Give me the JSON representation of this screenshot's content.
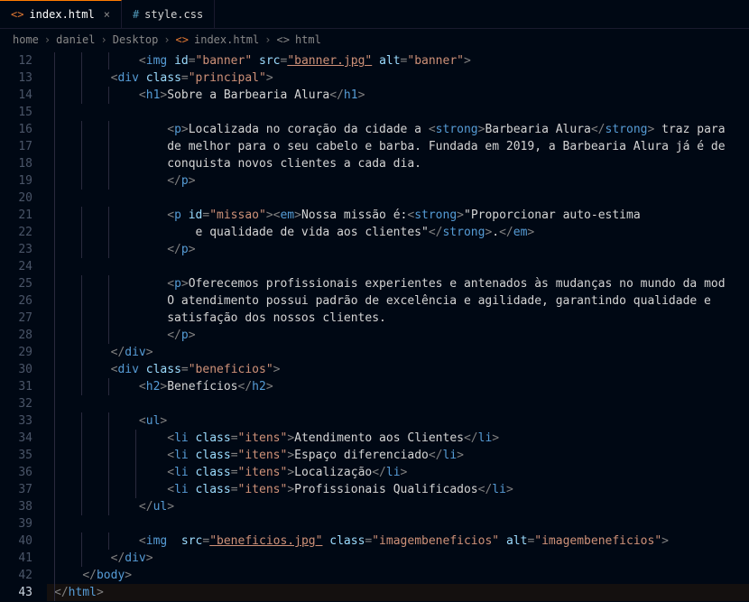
{
  "tabs": [
    {
      "icon": "<>",
      "label": "index.html",
      "active": true
    },
    {
      "icon": "#",
      "label": "style.css",
      "active": false
    }
  ],
  "breadcrumb": {
    "parts": [
      "home",
      "daniel",
      "Desktop"
    ],
    "file": "index.html",
    "symbol": "html"
  },
  "gutter_start": 12,
  "gutter_end": 43,
  "active_line": 43,
  "code_lines": [
    {
      "indent": 3,
      "tokens": [
        [
          "punct",
          "<"
        ],
        [
          "tag",
          "img"
        ],
        [
          "txt",
          " "
        ],
        [
          "attr",
          "id"
        ],
        [
          "punct",
          "="
        ],
        [
          "str",
          "\"banner\""
        ],
        [
          "txt",
          " "
        ],
        [
          "attr",
          "src"
        ],
        [
          "punct",
          "="
        ],
        [
          "str underline",
          "\"banner.jpg\""
        ],
        [
          "txt",
          " "
        ],
        [
          "attr",
          "alt"
        ],
        [
          "punct",
          "="
        ],
        [
          "str",
          "\"banner\""
        ],
        [
          "punct",
          ">"
        ]
      ]
    },
    {
      "indent": 2,
      "tokens": [
        [
          "punct",
          "<"
        ],
        [
          "tag",
          "div"
        ],
        [
          "txt",
          " "
        ],
        [
          "attr",
          "class"
        ],
        [
          "punct",
          "="
        ],
        [
          "str",
          "\"principal\""
        ],
        [
          "punct",
          ">"
        ]
      ]
    },
    {
      "indent": 3,
      "tokens": [
        [
          "punct",
          "<"
        ],
        [
          "tag",
          "h1"
        ],
        [
          "punct",
          ">"
        ],
        [
          "txt",
          "Sobre a Barbearia Alura"
        ],
        [
          "punct",
          "</"
        ],
        [
          "tag",
          "h1"
        ],
        [
          "punct",
          ">"
        ]
      ]
    },
    {
      "indent": 0,
      "tokens": []
    },
    {
      "indent": 3,
      "tokens": [
        [
          "punct",
          "    <"
        ],
        [
          "tag",
          "p"
        ],
        [
          "punct",
          ">"
        ],
        [
          "txt",
          "Localizada no coração da cidade a "
        ],
        [
          "punct",
          "<"
        ],
        [
          "tag",
          "strong"
        ],
        [
          "punct",
          ">"
        ],
        [
          "txt",
          "Barbearia Alura"
        ],
        [
          "punct",
          "</"
        ],
        [
          "tag",
          "strong"
        ],
        [
          "punct",
          ">"
        ],
        [
          "txt",
          " traz para"
        ]
      ]
    },
    {
      "indent": 3,
      "tokens": [
        [
          "txt",
          "    de melhor para o seu cabelo e barba. Fundada em 2019, a Barbearia Alura já é de"
        ]
      ]
    },
    {
      "indent": 3,
      "tokens": [
        [
          "txt",
          "    conquista novos clientes a cada dia."
        ]
      ]
    },
    {
      "indent": 3,
      "tokens": [
        [
          "punct",
          "    </"
        ],
        [
          "tag",
          "p"
        ],
        [
          "punct",
          ">"
        ]
      ]
    },
    {
      "indent": 0,
      "tokens": []
    },
    {
      "indent": 3,
      "tokens": [
        [
          "punct",
          "    <"
        ],
        [
          "tag",
          "p"
        ],
        [
          "txt",
          " "
        ],
        [
          "attr",
          "id"
        ],
        [
          "punct",
          "="
        ],
        [
          "str",
          "\"missao\""
        ],
        [
          "punct",
          "><"
        ],
        [
          "tag",
          "em"
        ],
        [
          "punct",
          ">"
        ],
        [
          "txt",
          "Nossa missão é:"
        ],
        [
          "punct",
          "<"
        ],
        [
          "tag",
          "strong"
        ],
        [
          "punct",
          ">"
        ],
        [
          "txt",
          "\"Proporcionar auto-estima"
        ]
      ]
    },
    {
      "indent": 3,
      "tokens": [
        [
          "txt",
          "        e qualidade de vida aos clientes\""
        ],
        [
          "punct",
          "</"
        ],
        [
          "tag",
          "strong"
        ],
        [
          "punct",
          ">"
        ],
        [
          "txt",
          "."
        ],
        [
          "punct",
          "</"
        ],
        [
          "tag",
          "em"
        ],
        [
          "punct",
          ">"
        ]
      ]
    },
    {
      "indent": 3,
      "tokens": [
        [
          "punct",
          "    </"
        ],
        [
          "tag",
          "p"
        ],
        [
          "punct",
          ">"
        ]
      ]
    },
    {
      "indent": 0,
      "tokens": []
    },
    {
      "indent": 3,
      "tokens": [
        [
          "punct",
          "    <"
        ],
        [
          "tag",
          "p"
        ],
        [
          "punct",
          ">"
        ],
        [
          "txt",
          "Oferecemos profissionais experientes e antenados às mudanças no mundo da mod"
        ]
      ]
    },
    {
      "indent": 3,
      "tokens": [
        [
          "txt",
          "    O atendimento possui padrão de excelência e agilidade, garantindo qualidade e"
        ]
      ]
    },
    {
      "indent": 3,
      "tokens": [
        [
          "txt",
          "    satisfação dos nossos clientes."
        ]
      ]
    },
    {
      "indent": 3,
      "tokens": [
        [
          "punct",
          "    </"
        ],
        [
          "tag",
          "p"
        ],
        [
          "punct",
          ">"
        ]
      ]
    },
    {
      "indent": 2,
      "tokens": [
        [
          "punct",
          "</"
        ],
        [
          "tag",
          "div"
        ],
        [
          "punct",
          ">"
        ]
      ]
    },
    {
      "indent": 2,
      "tokens": [
        [
          "punct",
          "<"
        ],
        [
          "tag",
          "div"
        ],
        [
          "txt",
          " "
        ],
        [
          "attr",
          "class"
        ],
        [
          "punct",
          "="
        ],
        [
          "str",
          "\"beneficios\""
        ],
        [
          "punct",
          ">"
        ]
      ]
    },
    {
      "indent": 3,
      "tokens": [
        [
          "punct",
          "<"
        ],
        [
          "tag",
          "h2"
        ],
        [
          "punct",
          ">"
        ],
        [
          "txt",
          "Benefícios"
        ],
        [
          "punct",
          "</"
        ],
        [
          "tag",
          "h2"
        ],
        [
          "punct",
          ">"
        ]
      ]
    },
    {
      "indent": 0,
      "tokens": []
    },
    {
      "indent": 3,
      "tokens": [
        [
          "punct",
          "<"
        ],
        [
          "tag",
          "ul"
        ],
        [
          "punct",
          ">"
        ]
      ]
    },
    {
      "indent": 4,
      "tokens": [
        [
          "punct",
          "<"
        ],
        [
          "tag",
          "li"
        ],
        [
          "txt",
          " "
        ],
        [
          "attr",
          "class"
        ],
        [
          "punct",
          "="
        ],
        [
          "str",
          "\"itens\""
        ],
        [
          "punct",
          ">"
        ],
        [
          "txt",
          "Atendimento aos Clientes"
        ],
        [
          "punct",
          "</"
        ],
        [
          "tag",
          "li"
        ],
        [
          "punct",
          ">"
        ]
      ]
    },
    {
      "indent": 4,
      "tokens": [
        [
          "punct",
          "<"
        ],
        [
          "tag",
          "li"
        ],
        [
          "txt",
          " "
        ],
        [
          "attr",
          "class"
        ],
        [
          "punct",
          "="
        ],
        [
          "str",
          "\"itens\""
        ],
        [
          "punct",
          ">"
        ],
        [
          "txt",
          "Espaço diferenciado"
        ],
        [
          "punct",
          "</"
        ],
        [
          "tag",
          "li"
        ],
        [
          "punct",
          ">"
        ]
      ]
    },
    {
      "indent": 4,
      "tokens": [
        [
          "punct",
          "<"
        ],
        [
          "tag",
          "li"
        ],
        [
          "txt",
          " "
        ],
        [
          "attr",
          "class"
        ],
        [
          "punct",
          "="
        ],
        [
          "str",
          "\"itens\""
        ],
        [
          "punct",
          ">"
        ],
        [
          "txt",
          "Localização"
        ],
        [
          "punct",
          "</"
        ],
        [
          "tag",
          "li"
        ],
        [
          "punct",
          ">"
        ]
      ]
    },
    {
      "indent": 4,
      "tokens": [
        [
          "punct",
          "<"
        ],
        [
          "tag",
          "li"
        ],
        [
          "txt",
          " "
        ],
        [
          "attr",
          "class"
        ],
        [
          "punct",
          "="
        ],
        [
          "str",
          "\"itens\""
        ],
        [
          "punct",
          ">"
        ],
        [
          "txt",
          "Profissionais Qualificados"
        ],
        [
          "punct",
          "</"
        ],
        [
          "tag",
          "li"
        ],
        [
          "punct",
          ">"
        ]
      ]
    },
    {
      "indent": 3,
      "tokens": [
        [
          "punct",
          "</"
        ],
        [
          "tag",
          "ul"
        ],
        [
          "punct",
          ">"
        ]
      ]
    },
    {
      "indent": 0,
      "tokens": []
    },
    {
      "indent": 3,
      "tokens": [
        [
          "punct",
          "<"
        ],
        [
          "tag",
          "img"
        ],
        [
          "txt",
          "  "
        ],
        [
          "attr",
          "src"
        ],
        [
          "punct",
          "="
        ],
        [
          "str underline",
          "\"beneficios.jpg\""
        ],
        [
          "txt",
          " "
        ],
        [
          "attr",
          "class"
        ],
        [
          "punct",
          "="
        ],
        [
          "str",
          "\"imagembeneficios\""
        ],
        [
          "txt",
          " "
        ],
        [
          "attr",
          "alt"
        ],
        [
          "punct",
          "="
        ],
        [
          "str",
          "\"imagembeneficios\""
        ],
        [
          "punct",
          ">"
        ]
      ]
    },
    {
      "indent": 2,
      "tokens": [
        [
          "punct",
          "</"
        ],
        [
          "tag",
          "div"
        ],
        [
          "punct",
          ">"
        ]
      ]
    },
    {
      "indent": 1,
      "tokens": [
        [
          "punct",
          "</"
        ],
        [
          "tag",
          "body"
        ],
        [
          "punct",
          ">"
        ]
      ]
    },
    {
      "indent": 0,
      "tokens": [
        [
          "punct",
          "</"
        ],
        [
          "tag",
          "html"
        ],
        [
          "punct",
          ">"
        ]
      ],
      "highlight": true
    }
  ]
}
